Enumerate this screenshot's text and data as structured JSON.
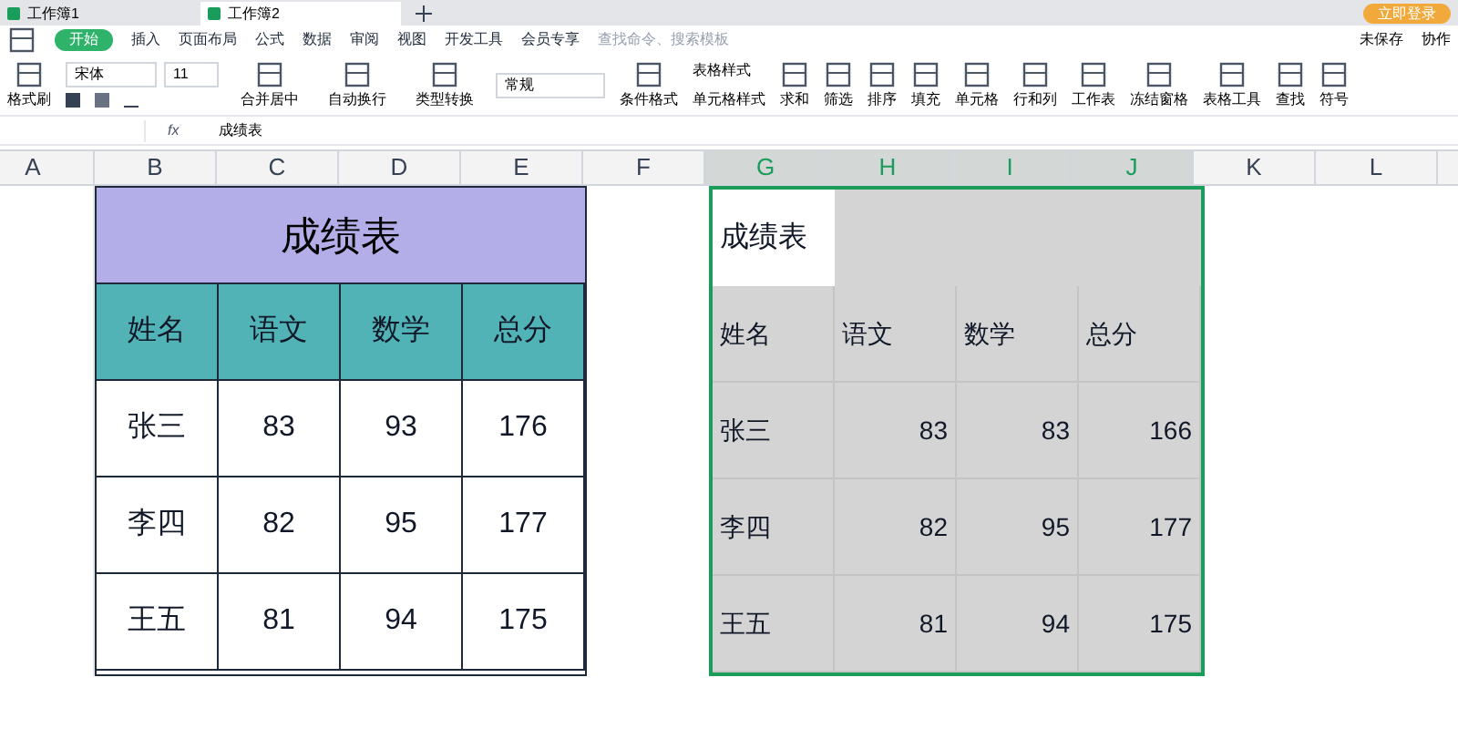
{
  "tabs": [
    {
      "label": "工作簿1",
      "selected": false
    },
    {
      "label": "工作簿2",
      "selected": true
    }
  ],
  "login": "立即登录",
  "menu": [
    {
      "label": "开始",
      "selected": true
    },
    {
      "label": "插入",
      "selected": false
    },
    {
      "label": "页面布局",
      "selected": false
    },
    {
      "label": "公式",
      "selected": false
    },
    {
      "label": "数据",
      "selected": false
    },
    {
      "label": "审阅",
      "selected": false
    },
    {
      "label": "视图",
      "selected": false
    },
    {
      "label": "开发工具",
      "selected": false
    },
    {
      "label": "会员专享",
      "selected": false
    }
  ],
  "search": {
    "placeholder": "查找命令、搜索模板"
  },
  "top_actions": [
    "未保存",
    "协作"
  ],
  "ribbon": {
    "format_painter": "格式刷",
    "font": "宋体",
    "size": "11",
    "number_format": "常规",
    "groups": [
      {
        "label": "合并居中"
      },
      {
        "label": "自动换行"
      },
      {
        "label": "类型转换"
      }
    ],
    "styles": [
      "表格样式",
      "单元格样式"
    ],
    "cond": "条件格式",
    "tools": [
      "求和",
      "筛选",
      "排序",
      "填充",
      "单元格",
      "行和列",
      "工作表",
      "冻结窗格",
      "表格工具",
      "查找",
      "符号"
    ]
  },
  "formula_bar": {
    "fx": "fx",
    "value": "成绩表"
  },
  "columns": [
    {
      "label": "A",
      "selected": false
    },
    {
      "label": "B",
      "selected": false
    },
    {
      "label": "C",
      "selected": false
    },
    {
      "label": "D",
      "selected": false
    },
    {
      "label": "E",
      "selected": false
    },
    {
      "label": "F",
      "selected": false
    },
    {
      "label": "G",
      "selected": true
    },
    {
      "label": "H",
      "selected": true
    },
    {
      "label": "I",
      "selected": true
    },
    {
      "label": "J",
      "selected": true
    },
    {
      "label": "K",
      "selected": false
    },
    {
      "label": "L",
      "selected": false
    }
  ],
  "table_left": {
    "title": "成绩表",
    "headers": [
      "姓名",
      "语文",
      "数学",
      "总分"
    ],
    "rows": [
      [
        "张三",
        "83",
        "93",
        "176"
      ],
      [
        "李四",
        "82",
        "95",
        "177"
      ],
      [
        "王五",
        "81",
        "94",
        "175"
      ]
    ]
  },
  "table_right": {
    "title": "成绩表",
    "headers": [
      "姓名",
      "语文",
      "数学",
      "总分"
    ],
    "rows": [
      [
        "张三",
        "83",
        "83",
        "166"
      ],
      [
        "李四",
        "82",
        "95",
        "177"
      ],
      [
        "王五",
        "81",
        "94",
        "175"
      ]
    ]
  }
}
